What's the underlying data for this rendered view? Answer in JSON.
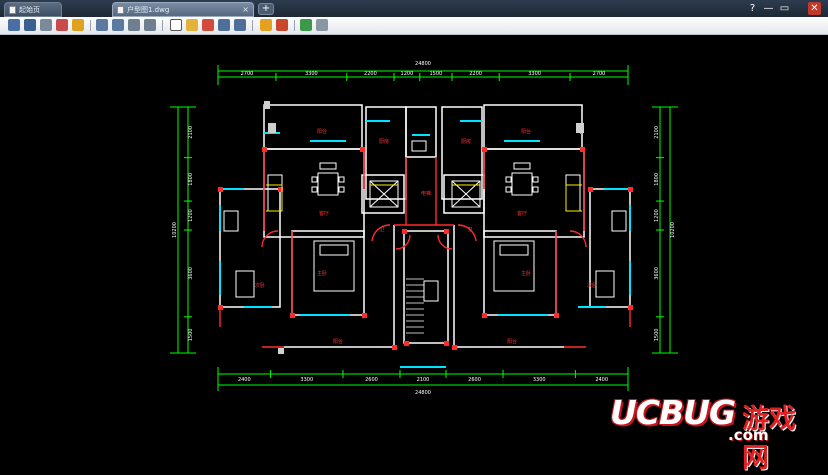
{
  "tabs": [
    {
      "label": "起始页",
      "active": false
    },
    {
      "label": "户型图1.dwg",
      "active": true
    }
  ],
  "new_tab_label": "+",
  "window_controls": [
    "?",
    "—",
    "▭",
    "✕"
  ],
  "toolbar_icons": [
    "open-icon",
    "save-icon",
    "print-icon",
    "layers-icon",
    "zoom-window-icon",
    "zoom-in-icon",
    "zoom-out-icon",
    "pan-icon",
    "line-icon",
    "pencil-icon",
    "measure-icon",
    "undo-icon",
    "redo-icon",
    "text-icon",
    "dimension-icon",
    "color-icon",
    "format-icon"
  ],
  "drawing": {
    "colors": {
      "dim": "#00ff00",
      "wall": "#ffffff",
      "door": "#ff2a2a",
      "window": "#00e5ff",
      "furniture": "#ffffff",
      "text": "#ff3030",
      "grid": "#ffee00"
    },
    "room_labels": [
      "阳台",
      "阳台",
      "厨房",
      "厨房",
      "客厅",
      "客厅",
      "主卧",
      "主卧",
      "次卧",
      "次卧",
      "阳台",
      "阳台",
      "卫",
      "卫",
      "电梯"
    ],
    "top_dims": [
      "2700",
      "3300",
      "2200",
      "1200",
      "1500",
      "2200",
      "3300",
      "2700"
    ],
    "top_total": "24800",
    "bottom_dims": [
      "2400",
      "3300",
      "2600",
      "2100",
      "2600",
      "3300",
      "2400"
    ],
    "bottom_total": "24800",
    "left_dims": [
      "2100",
      "1800",
      "1200",
      "3600",
      "1500"
    ],
    "left_total": "10200",
    "right_dims": [
      "2100",
      "1800",
      "1200",
      "3600",
      "1500"
    ],
    "right_total": "10200"
  },
  "watermark": {
    "brand": "UCBUG",
    "cn": "游戏网",
    "domain": ".com"
  }
}
